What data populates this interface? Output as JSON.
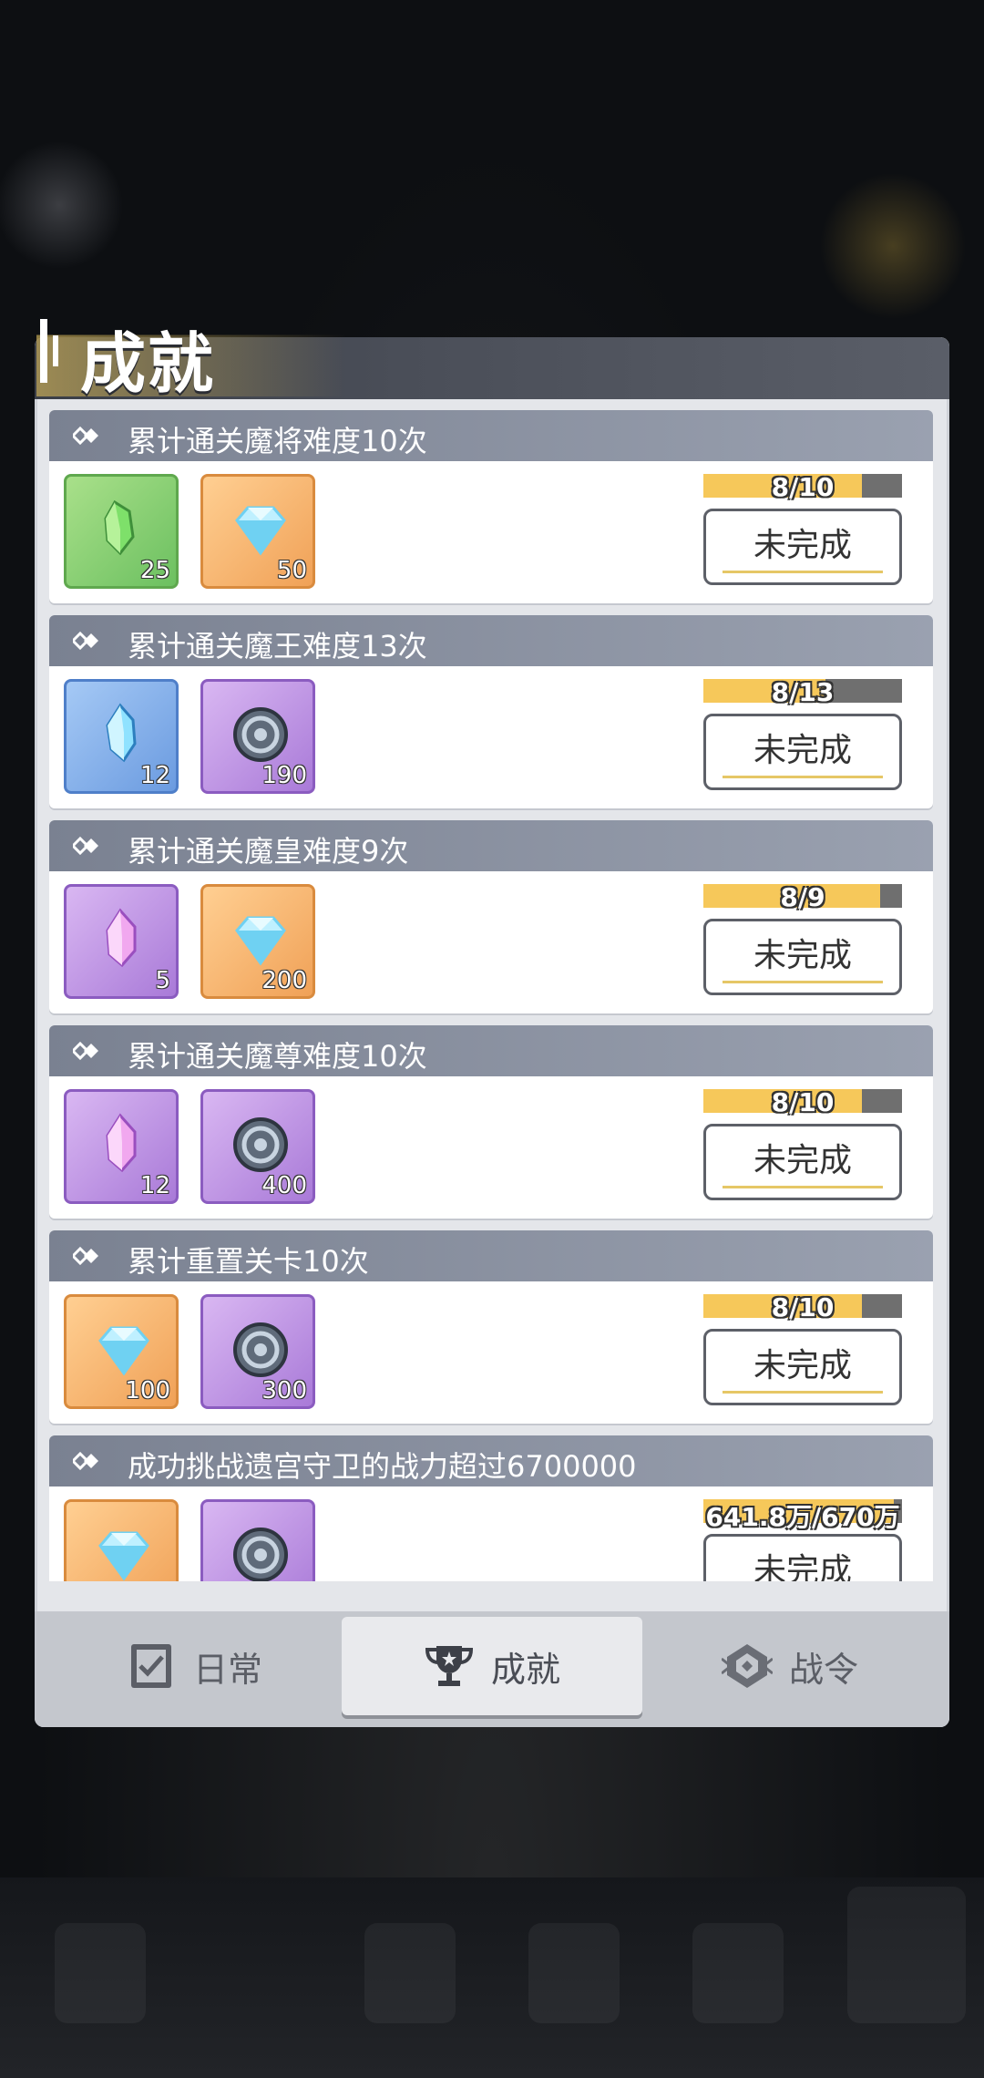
{
  "panel": {
    "title": "成就"
  },
  "achievements": [
    {
      "title": "累计通关魔将难度10次",
      "rewards": [
        {
          "icon": "green-crystal-icon",
          "count": "25",
          "bg": "green"
        },
        {
          "icon": "diamond-icon",
          "count": "50",
          "bg": "orange"
        }
      ],
      "progress_text": "8/10",
      "progress": 0.8,
      "status": "未完成"
    },
    {
      "title": "累计通关魔王难度13次",
      "rewards": [
        {
          "icon": "blue-crystal-icon",
          "count": "12",
          "bg": "blue"
        },
        {
          "icon": "gear-coin-icon",
          "count": "190",
          "bg": "purple"
        }
      ],
      "progress_text": "8/13",
      "progress": 0.615,
      "status": "未完成"
    },
    {
      "title": "累计通关魔皇难度9次",
      "rewards": [
        {
          "icon": "purple-crystal-icon",
          "count": "5",
          "bg": "purple"
        },
        {
          "icon": "diamond-icon",
          "count": "200",
          "bg": "orange"
        }
      ],
      "progress_text": "8/9",
      "progress": 0.889,
      "status": "未完成"
    },
    {
      "title": "累计通关魔尊难度10次",
      "rewards": [
        {
          "icon": "purple-crystal-icon",
          "count": "12",
          "bg": "purple"
        },
        {
          "icon": "gear-coin-icon",
          "count": "400",
          "bg": "purple"
        }
      ],
      "progress_text": "8/10",
      "progress": 0.8,
      "status": "未完成"
    },
    {
      "title": "累计重置关卡10次",
      "rewards": [
        {
          "icon": "diamond-icon",
          "count": "100",
          "bg": "orange"
        },
        {
          "icon": "gear-coin-icon",
          "count": "300",
          "bg": "purple"
        }
      ],
      "progress_text": "8/10",
      "progress": 0.8,
      "status": "未完成"
    },
    {
      "title": "成功挑战遗宫守卫的战力超过6700000",
      "rewards": [
        {
          "icon": "diamond-icon",
          "count": "",
          "bg": "orange"
        },
        {
          "icon": "gear-coin-icon",
          "count": "",
          "bg": "purple"
        }
      ],
      "progress_text": "641.8万/670万",
      "progress": 0.958,
      "status": "未完成"
    }
  ],
  "tabs": [
    {
      "label": "日常",
      "icon": "checklist-icon",
      "active": false
    },
    {
      "label": "成就",
      "icon": "trophy-icon",
      "active": true
    },
    {
      "label": "战令",
      "icon": "emblem-icon",
      "active": false
    }
  ],
  "colors": {
    "progress_fill": "#f6c85a",
    "card_header": "#8a91a0",
    "panel_bg": "#e4e6ea"
  }
}
